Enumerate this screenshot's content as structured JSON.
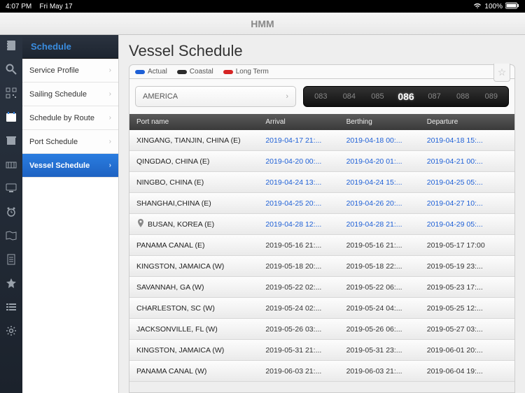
{
  "status": {
    "time": "4:07 PM",
    "date": "Fri May 17",
    "battery": "100%"
  },
  "app_title": "HMM",
  "sidebar": {
    "header": "Schedule",
    "items": [
      {
        "label": "Service Profile"
      },
      {
        "label": "Sailing Schedule"
      },
      {
        "label": "Schedule by Route"
      },
      {
        "label": "Port Schedule"
      },
      {
        "label": "Vessel Schedule"
      }
    ],
    "active_index": 4
  },
  "page": {
    "title": "Vessel Schedule",
    "legend": [
      {
        "label": "Actual",
        "color": "#1d5fd6"
      },
      {
        "label": "Coastal",
        "color": "#2b2b2b"
      },
      {
        "label": "Long Term",
        "color": "#d62424"
      }
    ],
    "dropdown_value": "AMERICA",
    "voyages": [
      "083",
      "084",
      "085",
      "086",
      "087",
      "088",
      "089"
    ],
    "voyage_active_index": 3,
    "columns": {
      "port": "Port name",
      "arrival": "Arrival",
      "berthing": "Berthing",
      "departure": "Departure"
    },
    "rows": [
      {
        "port": "XINGANG, TIANJIN, CHINA (E)",
        "arrival": "2019-04-17 21:...",
        "berthing": "2019-04-18 00:...",
        "departure": "2019-04-18 15:...",
        "type": "actual",
        "pin": false
      },
      {
        "port": "QINGDAO, CHINA (E)",
        "arrival": "2019-04-20 00:...",
        "berthing": "2019-04-20 01:...",
        "departure": "2019-04-21 00:...",
        "type": "actual",
        "pin": false
      },
      {
        "port": "NINGBO, CHINA (E)",
        "arrival": "2019-04-24 13:...",
        "berthing": "2019-04-24 15:...",
        "departure": "2019-04-25 05:...",
        "type": "actual",
        "pin": false
      },
      {
        "port": "SHANGHAI,CHINA (E)",
        "arrival": "2019-04-25 20:...",
        "berthing": "2019-04-26 20:...",
        "departure": "2019-04-27 10:...",
        "type": "actual",
        "pin": false
      },
      {
        "port": "BUSAN, KOREA (E)",
        "arrival": "2019-04-28 12:...",
        "berthing": "2019-04-28 21:...",
        "departure": "2019-04-29 05:...",
        "type": "actual",
        "pin": true
      },
      {
        "port": "PANAMA CANAL (E)",
        "arrival": "2019-05-16 21:...",
        "berthing": "2019-05-16 21:...",
        "departure": "2019-05-17 17:00",
        "type": "coastal",
        "pin": false
      },
      {
        "port": "KINGSTON, JAMAICA (W)",
        "arrival": "2019-05-18 20:...",
        "berthing": "2019-05-18 22:...",
        "departure": "2019-05-19 23:...",
        "type": "coastal",
        "pin": false
      },
      {
        "port": "SAVANNAH, GA (W)",
        "arrival": "2019-05-22 02:...",
        "berthing": "2019-05-22 06:...",
        "departure": "2019-05-23 17:...",
        "type": "coastal",
        "pin": false
      },
      {
        "port": "CHARLESTON, SC (W)",
        "arrival": "2019-05-24 02:...",
        "berthing": "2019-05-24 04:...",
        "departure": "2019-05-25 12:...",
        "type": "coastal",
        "pin": false
      },
      {
        "port": "JACKSONVILLE, FL (W)",
        "arrival": "2019-05-26 03:...",
        "berthing": "2019-05-26 06:...",
        "departure": "2019-05-27 03:...",
        "type": "coastal",
        "pin": false
      },
      {
        "port": "KINGSTON, JAMAICA (W)",
        "arrival": "2019-05-31 21:...",
        "berthing": "2019-05-31 23:...",
        "departure": "2019-06-01 20:...",
        "type": "coastal",
        "pin": false
      },
      {
        "port": "PANAMA CANAL (W)",
        "arrival": "2019-06-03 21:...",
        "berthing": "2019-06-03 21:...",
        "departure": "2019-06-04 19:...",
        "type": "coastal",
        "pin": false
      }
    ]
  }
}
